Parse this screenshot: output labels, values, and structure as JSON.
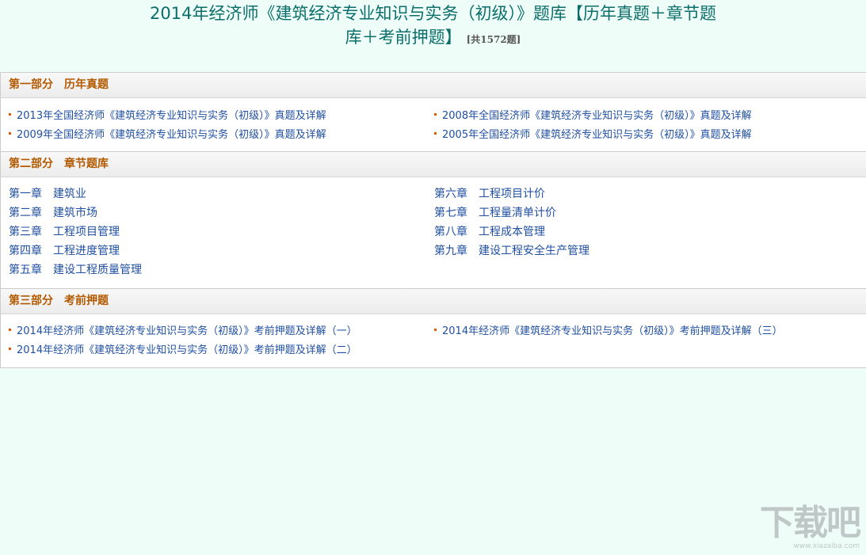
{
  "header": {
    "title_line1": "2014年经济师《建筑经济专业知识与实务（初级）》题库【历年真题＋章节题",
    "title_line2": "库＋考前押题】",
    "count": "[共1572题]"
  },
  "sections": [
    {
      "part": "第一部分",
      "name": "历年真题",
      "items": [
        "2013年全国经济师《建筑经济专业知识与实务（初级）》真题及详解",
        "2008年全国经济师《建筑经济专业知识与实务（初级）》真题及详解",
        "2009年全国经济师《建筑经济专业知识与实务（初级）》真题及详解",
        "2005年全国经济师《建筑经济专业知识与实务（初级）》真题及详解"
      ]
    },
    {
      "part": "第二部分",
      "name": "章节题库",
      "chapters": [
        {
          "num": "第一章",
          "title": "建筑业"
        },
        {
          "num": "第六章",
          "title": "工程项目计价"
        },
        {
          "num": "第二章",
          "title": "建筑市场"
        },
        {
          "num": "第七章",
          "title": "工程量清单计价"
        },
        {
          "num": "第三章",
          "title": "工程项目管理"
        },
        {
          "num": "第八章",
          "title": "工程成本管理"
        },
        {
          "num": "第四章",
          "title": "工程进度管理"
        },
        {
          "num": "第九章",
          "title": "建设工程安全生产管理"
        },
        {
          "num": "第五章",
          "title": "建设工程质量管理"
        }
      ]
    },
    {
      "part": "第三部分",
      "name": "考前押题",
      "items": [
        "2014年经济师《建筑经济专业知识与实务（初级）》考前押题及详解（一）",
        "2014年经济师《建筑经济专业知识与实务（初级）》考前押题及详解（三）",
        "2014年经济师《建筑经济专业知识与实务（初级）》考前押题及详解（二）"
      ]
    }
  ],
  "watermark": {
    "logo_text": "下载吧",
    "url_text": "www.xiazaiba.com"
  }
}
